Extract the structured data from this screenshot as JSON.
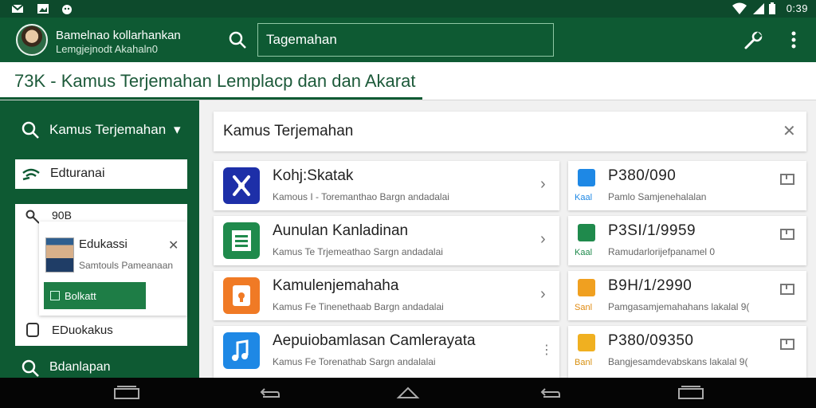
{
  "status_bar": {
    "time": "0:39",
    "icons": [
      "mail-icon",
      "photo-icon",
      "android-icon",
      "wifi-icon",
      "signal-icon",
      "battery-icon"
    ]
  },
  "app_bar": {
    "name": "Bamelnao kollarhankan",
    "subtitle": "Lemgjejnodt Akahaln0",
    "search_value": "Tagemahan",
    "search_placeholder": "Tagemahan"
  },
  "page": {
    "title": "73K - Kamus Terjemahan Lemplacp dan dan Akarat"
  },
  "sidebar": {
    "search_label": "Kamus Terjemahan",
    "edu_label": "Edturanai",
    "code_label": "90B",
    "profile_name": "Edukassi",
    "profile_sub": "Samtouls Pameanaan",
    "profile_button": "Bolkatt",
    "bookmark_label": "EDuokakus",
    "bottom_label": "Bdanlapan"
  },
  "main": {
    "header_label": "Kamus Terjemahan",
    "items": [
      {
        "title": "Kohj:Skatak",
        "subtitle": "Kamous I - Toremanthao Bargn andadalai",
        "icon": "app-x-icon",
        "color": "#1d2fa8"
      },
      {
        "title": "Aunulan Kanladinan",
        "subtitle": "Kamus Te Trjemeathao Sargn andadalai",
        "icon": "app-doc-icon",
        "color": "#1f8a4c"
      },
      {
        "title": "Kamulenjemahaha",
        "subtitle": "Kamus Fe Tinenethaab Bargn andadalai",
        "icon": "app-lock-icon",
        "color": "#f07a25"
      },
      {
        "title": "Aepuiobamlasan Camlerayata",
        "subtitle": "Kamus Fe Torenathab Sargn andalalai",
        "icon": "app-music-icon",
        "color": "#1e88e5"
      }
    ],
    "side_items": [
      {
        "code": "P380/090",
        "label": "Kaal",
        "subtitle": "Pamlo Samjenehalalan",
        "color": "#1e88e5"
      },
      {
        "code": "P3SI/1/9959",
        "label": "Kaal",
        "subtitle": "Ramudarlorijefpanamel 0",
        "color": "#1f8a4c"
      },
      {
        "code": "B9H/1/2990",
        "label": "Sanl",
        "subtitle": "Pamgasamjemahahans lakalal 9(",
        "color": "#f0a020"
      },
      {
        "code": "P380/09350",
        "label": "Banl",
        "subtitle": "Bangjesamdevabskans lakalal 9(",
        "color": "#f0b020"
      }
    ]
  },
  "colors": {
    "primary": "#0e5a33",
    "accent": "#1e7d46"
  }
}
